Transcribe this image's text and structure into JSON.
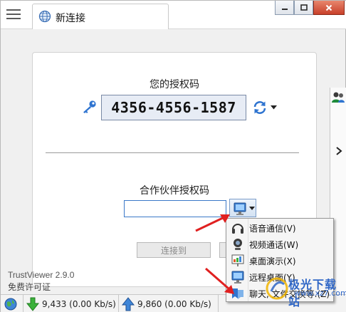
{
  "titlebar": {
    "tab_label": "新连接"
  },
  "main": {
    "my_code_title": "您的授权码",
    "my_code_value": "4356-4556-1587",
    "partner_title": "合作伙伴授权码",
    "partner_input_value": "",
    "connect_button_label": "连接到"
  },
  "branding": {
    "product_version": "TrustViewer 2.9.0",
    "license": "免费许可证"
  },
  "statusbar": {
    "download": "9,433 (0.00 Kb/s)",
    "upload": "9,860   (0.00 Kb/s)"
  },
  "popup_menu": {
    "items": [
      {
        "label": "语音通信(V)",
        "icon": "headset-icon"
      },
      {
        "label": "视频通话(W)",
        "icon": "webcam-icon"
      },
      {
        "label": "桌面演示(X)",
        "icon": "presentation-icon"
      },
      {
        "label": "远程桌面(Y)",
        "icon": "monitor-icon"
      },
      {
        "label": "聊天, 文件交换等.(Z)",
        "icon": "chat-icon"
      }
    ]
  },
  "watermark": {
    "text": "极光下载站",
    "url": "www.xz7.com"
  },
  "colors": {
    "accent": "#3a78c8",
    "code_box_bg": "#e7ecf5",
    "close_button": "#c8402a",
    "arrow_red": "#e02020"
  }
}
